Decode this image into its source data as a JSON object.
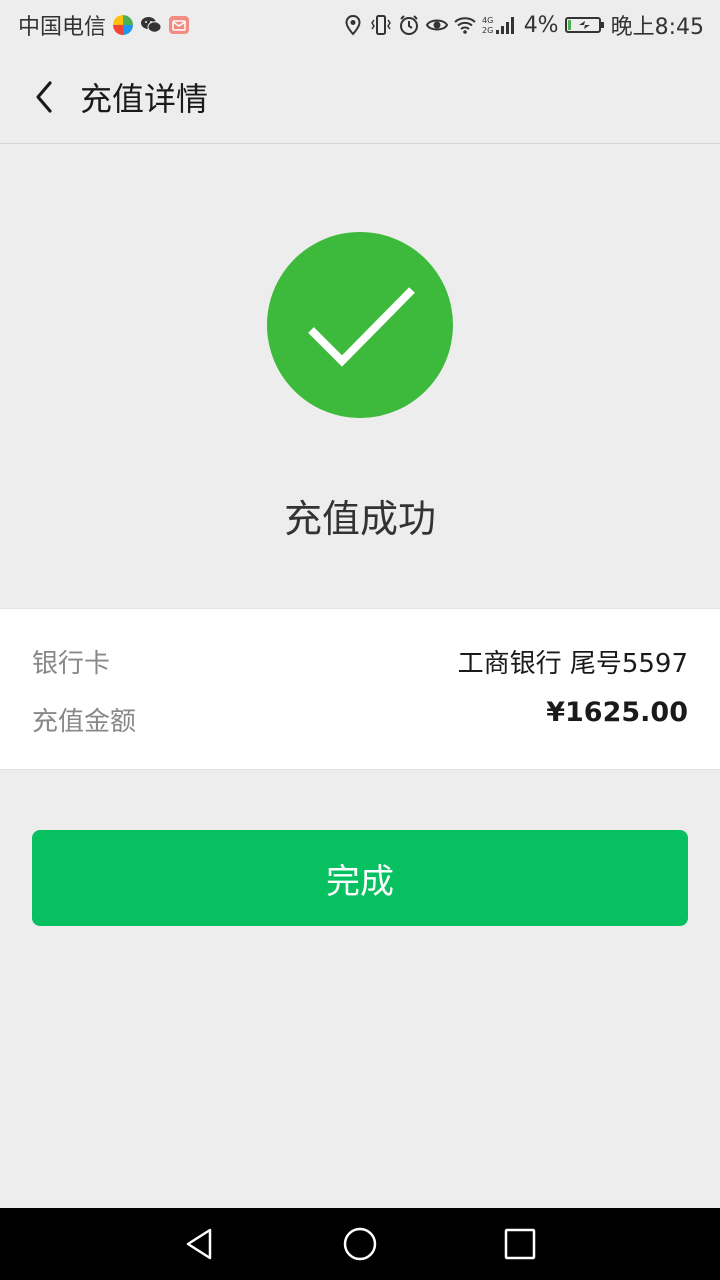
{
  "status_bar": {
    "carrier": "中国电信",
    "network": "4G 2G",
    "battery_percent": "4%",
    "time": "晚上8:45",
    "icons": [
      "app-icon",
      "wechat-icon",
      "mail-icon",
      "location-icon",
      "vibrate-icon",
      "alarm-icon",
      "eye-icon",
      "wifi-icon",
      "signal-icon",
      "battery-charging-icon"
    ]
  },
  "nav": {
    "back_icon": "chevron-left-icon",
    "title": "充值详情"
  },
  "result": {
    "icon": "check-circle-icon",
    "title": "充值成功",
    "color": "#3DB93B"
  },
  "details": {
    "bank_label": "银行卡",
    "bank_value": "工商银行 尾号5597",
    "amount_label": "充值金额",
    "amount_value": "¥1625.00"
  },
  "actions": {
    "done_label": "完成",
    "done_color": "#07C160"
  },
  "system_nav": {
    "icons": [
      "triangle-back-icon",
      "circle-home-icon",
      "square-recent-icon"
    ]
  }
}
